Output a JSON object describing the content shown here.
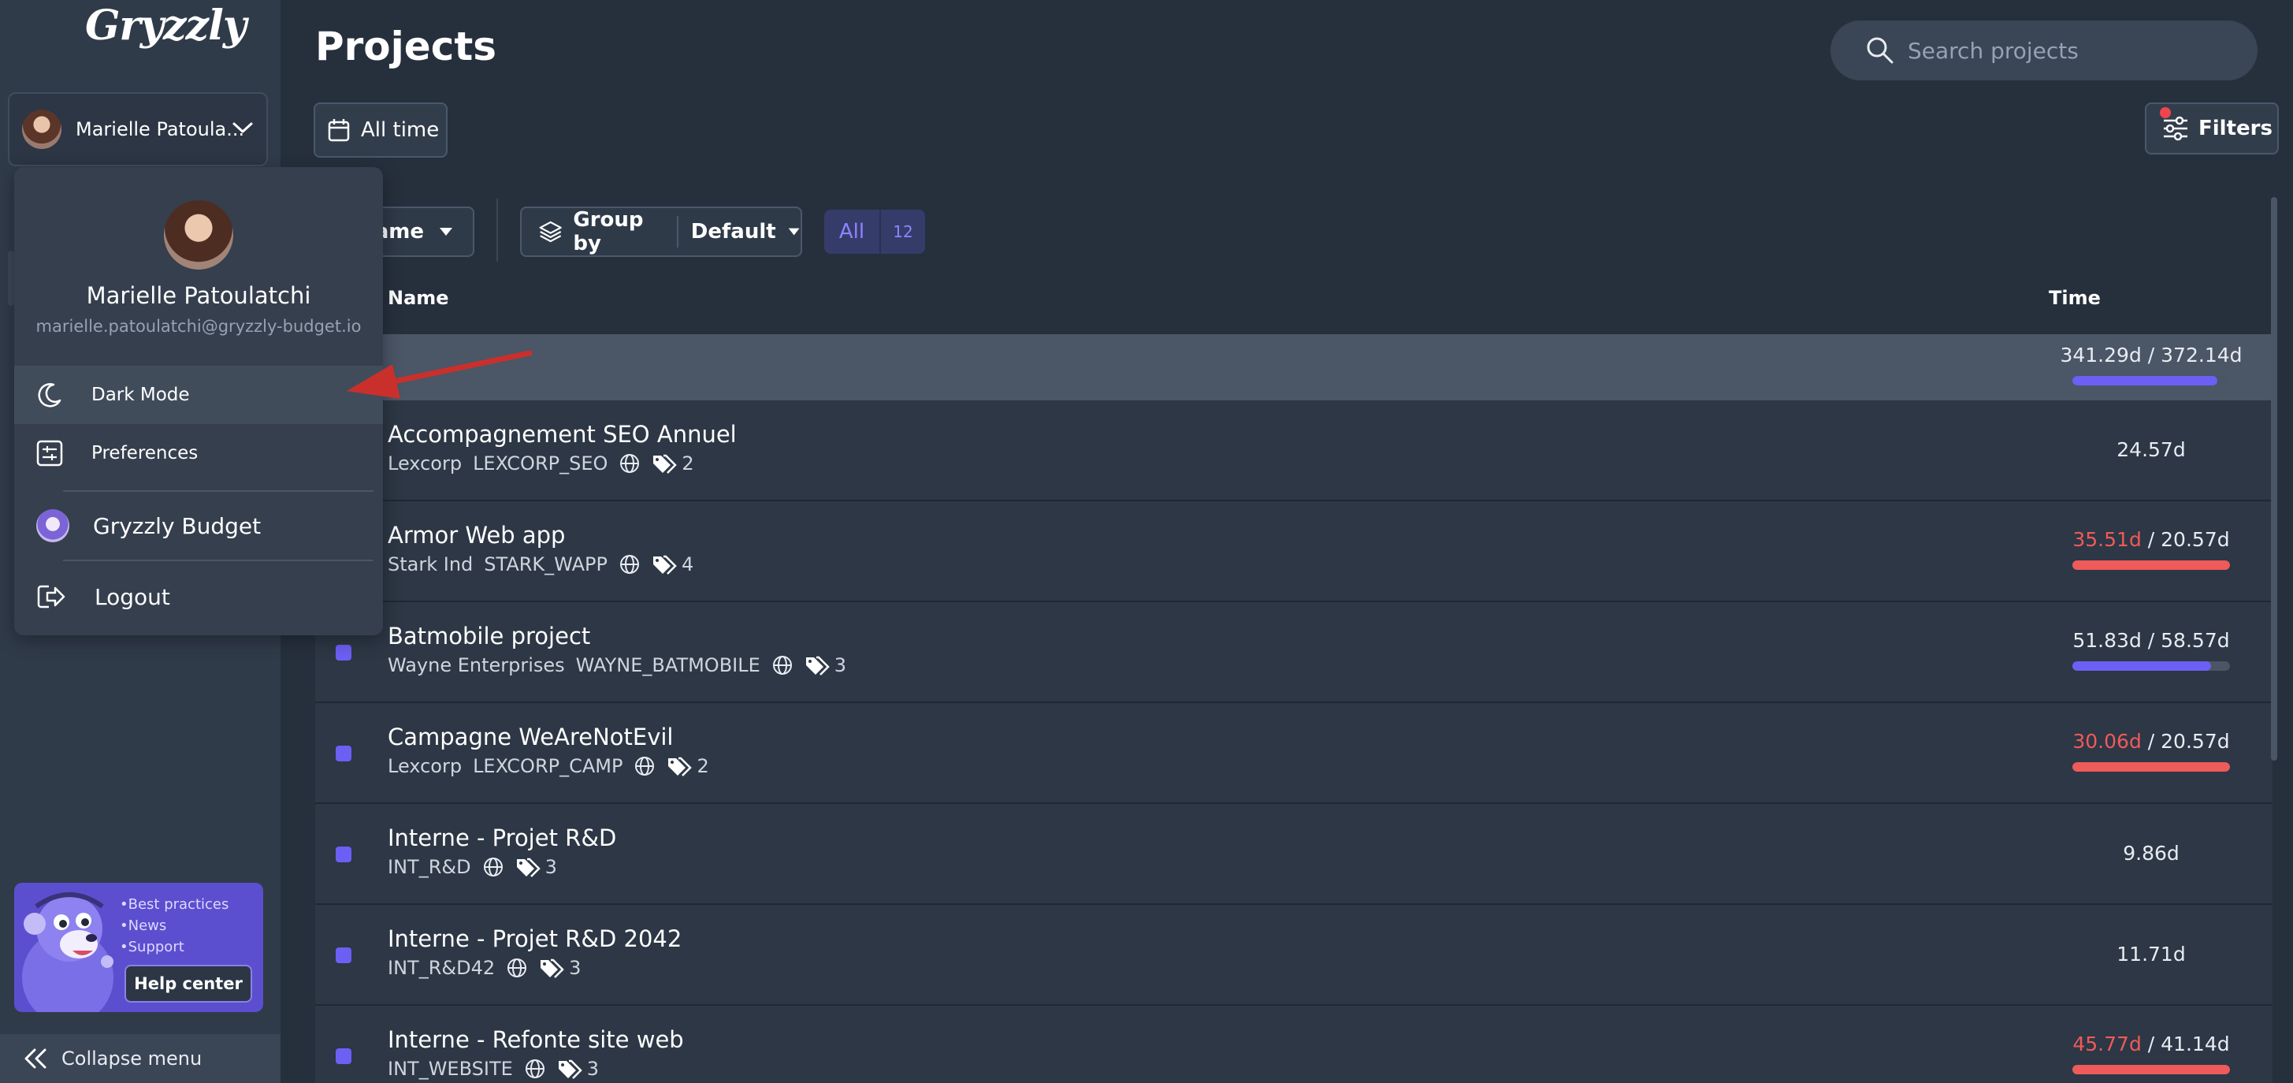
{
  "app": {
    "logo_text": "Gryzzly"
  },
  "sidebar": {
    "user_display_name": "Marielle Patoula...",
    "help_card": {
      "bullets": [
        "•Best practices",
        "•News",
        "•Support"
      ],
      "button_label": "Help center"
    },
    "collapse_label": "Collapse menu"
  },
  "user_menu": {
    "full_name": "Marielle Patoulatchi",
    "email": "marielle.patoulatchi@gryzzly-budget.io",
    "items": [
      {
        "label": "Dark Mode",
        "icon": "moon-icon"
      },
      {
        "label": "Preferences",
        "icon": "preferences-icon"
      },
      {
        "label": "Gryzzly Budget",
        "icon": "gryzzly-budget-logo"
      },
      {
        "label": "Logout",
        "icon": "logout-icon"
      }
    ]
  },
  "header": {
    "title": "Projects",
    "search_placeholder": "Search projects",
    "date_filter_label": "All time",
    "filters_label": "Filters"
  },
  "toolbar": {
    "sort_label": "ame",
    "group_by_label": "Group by",
    "group_by_value": "Default",
    "all_label": "All",
    "all_count": "12"
  },
  "table": {
    "columns": {
      "name": "Name",
      "time": "Time"
    },
    "total": {
      "spent": "341.29d",
      "sep": " / ",
      "budget": "372.14d",
      "progress": 0.92,
      "over": false
    },
    "rows": [
      {
        "name": "Accompagnement SEO Annuel",
        "client": "Lexcorp",
        "code": "LEXCORP_SEO",
        "tags": "2",
        "spent": "24.57d",
        "sep": "",
        "budget": "",
        "progress": null,
        "over": false,
        "checkbox": false
      },
      {
        "name": "Armor Web app",
        "client": "Stark Ind",
        "code": "STARK_WAPP",
        "tags": "4",
        "spent": "35.51d",
        "sep": " / ",
        "budget": "20.57d",
        "progress": 1.0,
        "over": true,
        "checkbox": false
      },
      {
        "name": "Batmobile project",
        "client": "Wayne Enterprises",
        "code": "WAYNE_BATMOBILE",
        "tags": "3",
        "spent": "51.83d",
        "sep": " / ",
        "budget": "58.57d",
        "progress": 0.88,
        "over": false,
        "checkbox": true
      },
      {
        "name": "Campagne WeAreNotEvil",
        "client": "Lexcorp",
        "code": "LEXCORP_CAMP",
        "tags": "2",
        "spent": "30.06d",
        "sep": " / ",
        "budget": "20.57d",
        "progress": 1.0,
        "over": true,
        "checkbox": true
      },
      {
        "name": "Interne - Projet R&D",
        "client": "",
        "code": "INT_R&D",
        "tags": "3",
        "spent": "9.86d",
        "sep": "",
        "budget": "",
        "progress": null,
        "over": false,
        "checkbox": true
      },
      {
        "name": "Interne - Projet R&D 2042",
        "client": "",
        "code": "INT_R&D42",
        "tags": "3",
        "spent": "11.71d",
        "sep": "",
        "budget": "",
        "progress": null,
        "over": false,
        "checkbox": true
      },
      {
        "name": "Interne - Refonte site web",
        "client": "",
        "code": "INT_WEBSITE",
        "tags": "3",
        "spent": "45.77d",
        "sep": " / ",
        "budget": "41.14d",
        "progress": 1.0,
        "over": true,
        "checkbox": true
      }
    ]
  },
  "colors": {
    "accent": "#6c5ff4",
    "over_budget": "#ef5a5a",
    "arrow": "#c9302c"
  }
}
